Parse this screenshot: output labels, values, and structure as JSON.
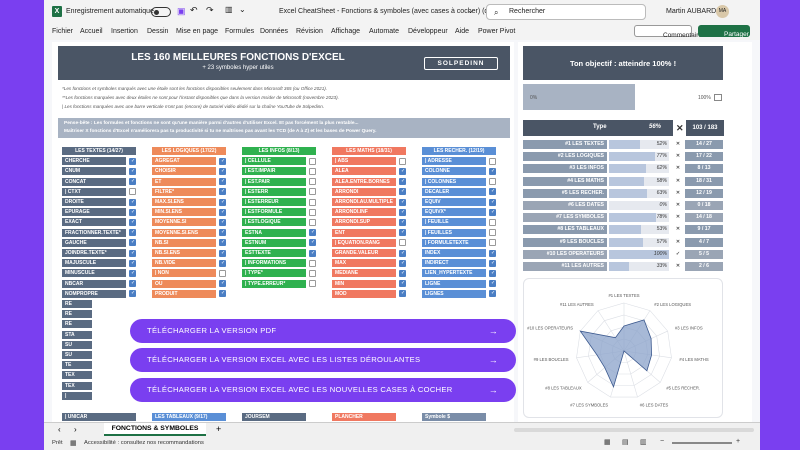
{
  "window": {
    "autosave_label": "Enregistrement automatique",
    "doc_title": "Excel CheatSheet - Fonctions & symboles (avec cases à cocher) (déjà com...",
    "search_placeholder": "Rechercher",
    "user_name": "Martin AUBARD",
    "user_initials": "MA"
  },
  "ribbon": {
    "tabs": [
      "Fichier",
      "Accueil",
      "Insertion",
      "Dessin",
      "Mise en page",
      "Formules",
      "Données",
      "Révision",
      "Affichage",
      "Automate",
      "Développeur",
      "Aide",
      "Power Pivot"
    ],
    "comments_label": "Commentaires",
    "share_label": "Partager"
  },
  "sheet": {
    "title": "LES 160 MEILLEURES FONCTIONS D'EXCEL",
    "subtitle": "+ 23 symboles hyper utiles",
    "brand": "SOLPEDINN",
    "notes": [
      "*Les fonctions et symboles marqués avec une étoile sont les fonctions disponibles seulement dans Microsoft 365 (ou Office 2021).",
      "**Les fonctions marquées avec deux étoiles ne sont pour l'instant disponibles que dans la version Insider de Microsoft (novembre 2023).",
      "| Les fonctions marquées avec une barre verticale n'ont pas (encore) de tutoriel vidéo dédié sur la chaîne YouTube de Solpedinn."
    ],
    "tip_line1": "Pense-bête : Les formules et fonctions ne sont qu'une manière parmi d'autres d'utiliser Excel. Et pas forcément la plus rentable...",
    "tip_line2": "Maîtriser X fonctions d'Excel n'améliorera pas ta productivité si tu ne maîtrises pas avant les TCD (de A à Z) et les bases de Power Query.",
    "objective": "Ton objectif : atteindre 100% !",
    "progress_left": "0%",
    "progress_right": "100%",
    "progress_value": 0.56,
    "type_label": "Type",
    "type_pct": "56%",
    "type_count": "103 / 183"
  },
  "columns": [
    {
      "title": "LES TEXTES (14/27)",
      "color": "#5a6b82",
      "items": [
        "CHERCHE",
        "CNUM",
        "CONCAT",
        "| CTXT",
        "DROITE",
        "EPURAGE",
        "EXACT",
        "FRACTIONNER.TEXTE*",
        "GAUCHE",
        "JOINDRE.TEXTE*",
        "MAJUSCULE",
        "MINUSCULE",
        "NBCAR",
        "NOMPROPRE"
      ],
      "checks": [
        1,
        1,
        1,
        0,
        1,
        1,
        1,
        1,
        1,
        1,
        1,
        1,
        1,
        1
      ]
    },
    {
      "title": "LES LOGIQUES (17/22)",
      "color": "#ee8a5a",
      "items": [
        "AGREGAT",
        "CHOISIR",
        "ET",
        "FILTRE*",
        "MAX.SI.ENS",
        "MIN.SI.ENS",
        "MOYENNE.SI",
        "MOYENNE.SI.ENS",
        "NB.SI",
        "NB.SI.ENS",
        "NB.VIDE",
        "| NON",
        "OU",
        "PRODUIT"
      ],
      "checks": [
        1,
        1,
        1,
        1,
        1,
        1,
        1,
        1,
        1,
        1,
        1,
        0,
        1,
        1
      ]
    },
    {
      "title": "LES INFOS (8/13)",
      "color": "#2fb14f",
      "items": [
        "| CELLULE",
        "| EST.IMPAIR",
        "| EST.PAIR",
        "| ESTERR",
        "| ESTERREUR",
        "| ESTFORMULE",
        "| ESTLOGIQUE",
        "ESTNA",
        "ESTNUM",
        "ESTTEXTE",
        "| INFORMATIONS",
        "| TYPE*",
        "| TYPE.ERREUR*"
      ],
      "checks": [
        0,
        0,
        0,
        0,
        0,
        0,
        0,
        1,
        1,
        1,
        0,
        0,
        0
      ]
    },
    {
      "title": "LES MATHS (18/31)",
      "color": "#f07860",
      "items": [
        "| ABS",
        "ALEA",
        "ALEA.ENTRE.BORNES",
        "ARRONDI",
        "ARRONDI.AU.MULTIPLE",
        "ARRONDI.INF",
        "ARRONDI.SUP",
        "ENT",
        "| EQUATION.RANG",
        "GRANDE.VALEUR",
        "MAX",
        "MEDIANE",
        "MIN",
        "MOD"
      ],
      "checks": [
        0,
        1,
        1,
        1,
        1,
        1,
        1,
        1,
        0,
        1,
        1,
        1,
        1,
        1
      ]
    },
    {
      "title": "LES RECHER. (12/19)",
      "color": "#5a8fd6",
      "items": [
        "| ADRESSE",
        "COLONNE",
        "| COLONNES",
        "DECALER",
        "EQUIV",
        "EQUIVX*",
        "| FEUILLE",
        "| FEUILLES",
        "| FORMULETEXTE",
        "INDEX",
        "INDIRECT",
        "LIEN_HYPERTEXTE",
        "LIGNE",
        "LIGNES"
      ],
      "checks": [
        0,
        1,
        0,
        1,
        1,
        1,
        0,
        0,
        0,
        1,
        1,
        1,
        1,
        1
      ]
    }
  ],
  "left_stub": [
    "RE",
    "RE",
    "RE",
    "STA",
    "SU",
    "SU",
    "TE",
    "TEX",
    "TEX",
    "| "
  ],
  "bottom_cells": {
    "c1": "| UNICAR",
    "c2": "LES TABLEAUX (9/17)",
    "c3": "JOURSEM",
    "c4": "PLANCHER",
    "c5": "Symbole $"
  },
  "stats": [
    {
      "label": "#1 LES TEXTES",
      "pct": "52%",
      "value": 0.52,
      "count": "14 / 27",
      "mark": "✕"
    },
    {
      "label": "#2 LES LOGIQUES",
      "pct": "77%",
      "value": 0.77,
      "count": "17 / 22",
      "mark": "✕"
    },
    {
      "label": "#3 LES INFOS",
      "pct": "62%",
      "value": 0.62,
      "count": "8 / 13",
      "mark": "✕"
    },
    {
      "label": "#4 LES MATHS",
      "pct": "58%",
      "value": 0.58,
      "count": "18 / 31",
      "mark": "✕"
    },
    {
      "label": "#5 LES RECHER.",
      "pct": "63%",
      "value": 0.63,
      "count": "12 / 19",
      "mark": "✕"
    },
    {
      "label": "#6 LES DATES",
      "pct": "0%",
      "value": 0.0,
      "count": "0 / 18",
      "mark": "✕"
    },
    {
      "label": "#7 LES SYMBOLES",
      "pct": "78%",
      "value": 0.78,
      "count": "14 / 18",
      "mark": "✕"
    },
    {
      "label": "#8 LES TABLEAUX",
      "pct": "53%",
      "value": 0.53,
      "count": "9 / 17",
      "mark": "✕"
    },
    {
      "label": "#9 LES BOUCLES",
      "pct": "57%",
      "value": 0.57,
      "count": "4 / 7",
      "mark": "✕"
    },
    {
      "label": "#10 LES OPERATEURS",
      "pct": "100%",
      "value": 1.0,
      "count": "5 / 5",
      "mark": "✓"
    },
    {
      "label": "#11 LES AUTRES",
      "pct": "33%",
      "value": 0.33,
      "count": "2 / 6",
      "mark": "✕"
    }
  ],
  "radar_labels": [
    "#1 LES TEXTES",
    "#2 LES LOGIQUES",
    "#3 LES INFOS",
    "#4 LES MATHS",
    "#5 LES RECHER.",
    "#6 LES DATES",
    "#7 LES SYMBOLES",
    "#8 LES TABLEAUX",
    "#9 LES BOUCLES",
    "#10 LES OPERATEURS",
    "#11 LES AUTRES"
  ],
  "downloads": [
    "TÉLÉCHARGER LA VERSION PDF",
    "TÉLÉCHARGER LA VERSION EXCEL AVEC LES LISTES DÉROULANTES",
    "TÉLÉCHARGER LA VERSION EXCEL AVEC LES NOUVELLES CASES À COCHER"
  ],
  "sheet_tab": "FONCTIONS & SYMBOLES",
  "add_sheet": "+",
  "status": {
    "ready": "Prêt",
    "accessibility": "Accessibilité : consultez nos recommandations"
  },
  "colors": {
    "accent": "#7a3ff0",
    "excel_green": "#1e7145",
    "header": "#4a5565"
  }
}
